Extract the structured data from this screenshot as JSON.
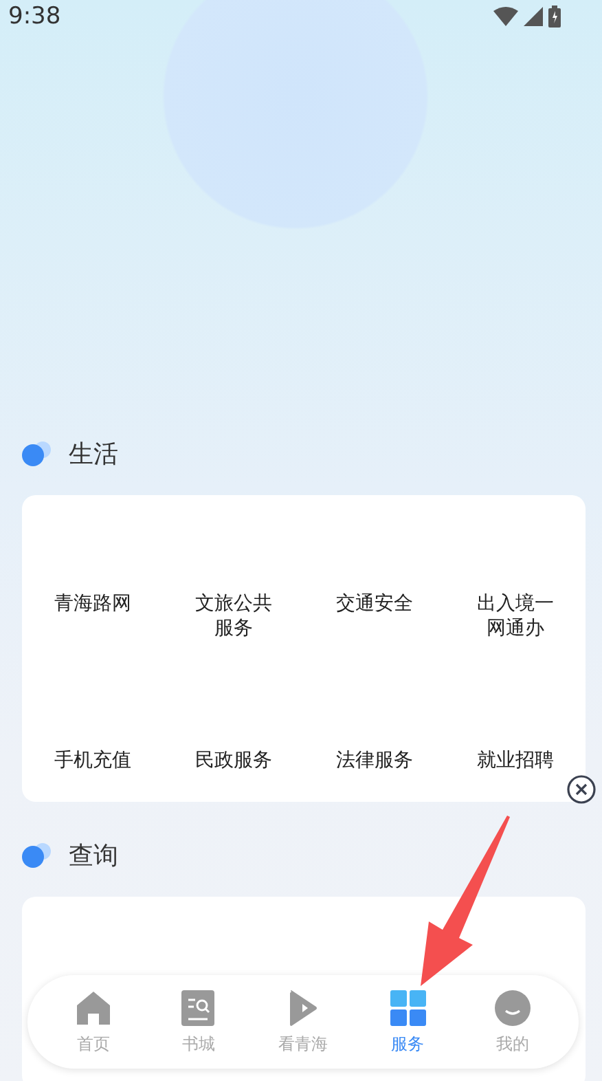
{
  "status_bar": {
    "time": "9:38"
  },
  "sections": [
    {
      "title": "生活",
      "items": [
        "青海路网",
        "文旅公共服务",
        "交通安全",
        "出入境一网通办",
        "手机充值",
        "民政服务",
        "法律服务",
        "就业招聘"
      ]
    },
    {
      "title": "查询"
    }
  ],
  "bottom_nav": [
    {
      "label": "首页",
      "kind": "home",
      "selected": false
    },
    {
      "label": "书城",
      "kind": "book",
      "selected": false
    },
    {
      "label": "看青海",
      "kind": "play",
      "selected": false
    },
    {
      "label": "服务",
      "kind": "grid",
      "selected": true
    },
    {
      "label": "我的",
      "kind": "face",
      "selected": false
    }
  ]
}
